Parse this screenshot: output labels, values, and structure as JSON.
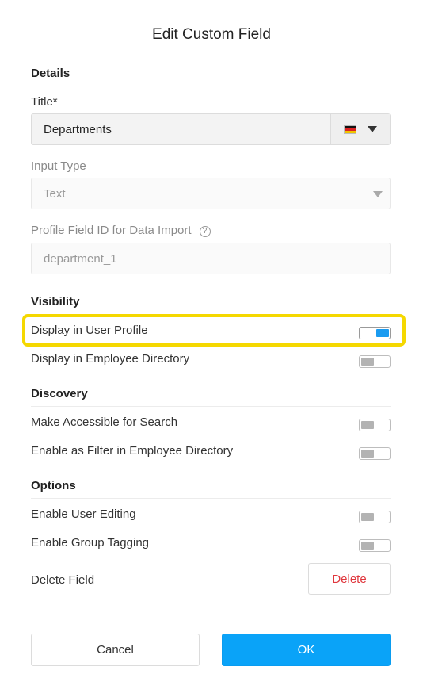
{
  "dialog": {
    "title": "Edit Custom Field"
  },
  "details": {
    "heading": "Details",
    "title_label": "Title*",
    "title_value": "Departments",
    "lang_icon": "german-flag-icon",
    "input_type_label": "Input Type",
    "input_type_value": "Text",
    "profile_field_label": "Profile Field ID for Data Import",
    "profile_field_value": "department_1"
  },
  "visibility": {
    "heading": "Visibility",
    "display_user_profile": {
      "label": "Display in User Profile",
      "on": true
    },
    "display_employee_directory": {
      "label": "Display in Employee Directory",
      "on": false
    }
  },
  "discovery": {
    "heading": "Discovery",
    "accessible_search": {
      "label": "Make Accessible for Search",
      "on": false
    },
    "filter_directory": {
      "label": "Enable as Filter in Employee Directory",
      "on": false
    }
  },
  "options": {
    "heading": "Options",
    "user_editing": {
      "label": "Enable User Editing",
      "on": false
    },
    "group_tagging": {
      "label": "Enable Group Tagging",
      "on": false
    },
    "delete_field_label": "Delete Field",
    "delete_button": "Delete"
  },
  "footer": {
    "cancel": "Cancel",
    "ok": "OK"
  },
  "colors": {
    "accent": "#0aa3f8",
    "highlight": "#f5d800",
    "danger": "#e0383e"
  }
}
